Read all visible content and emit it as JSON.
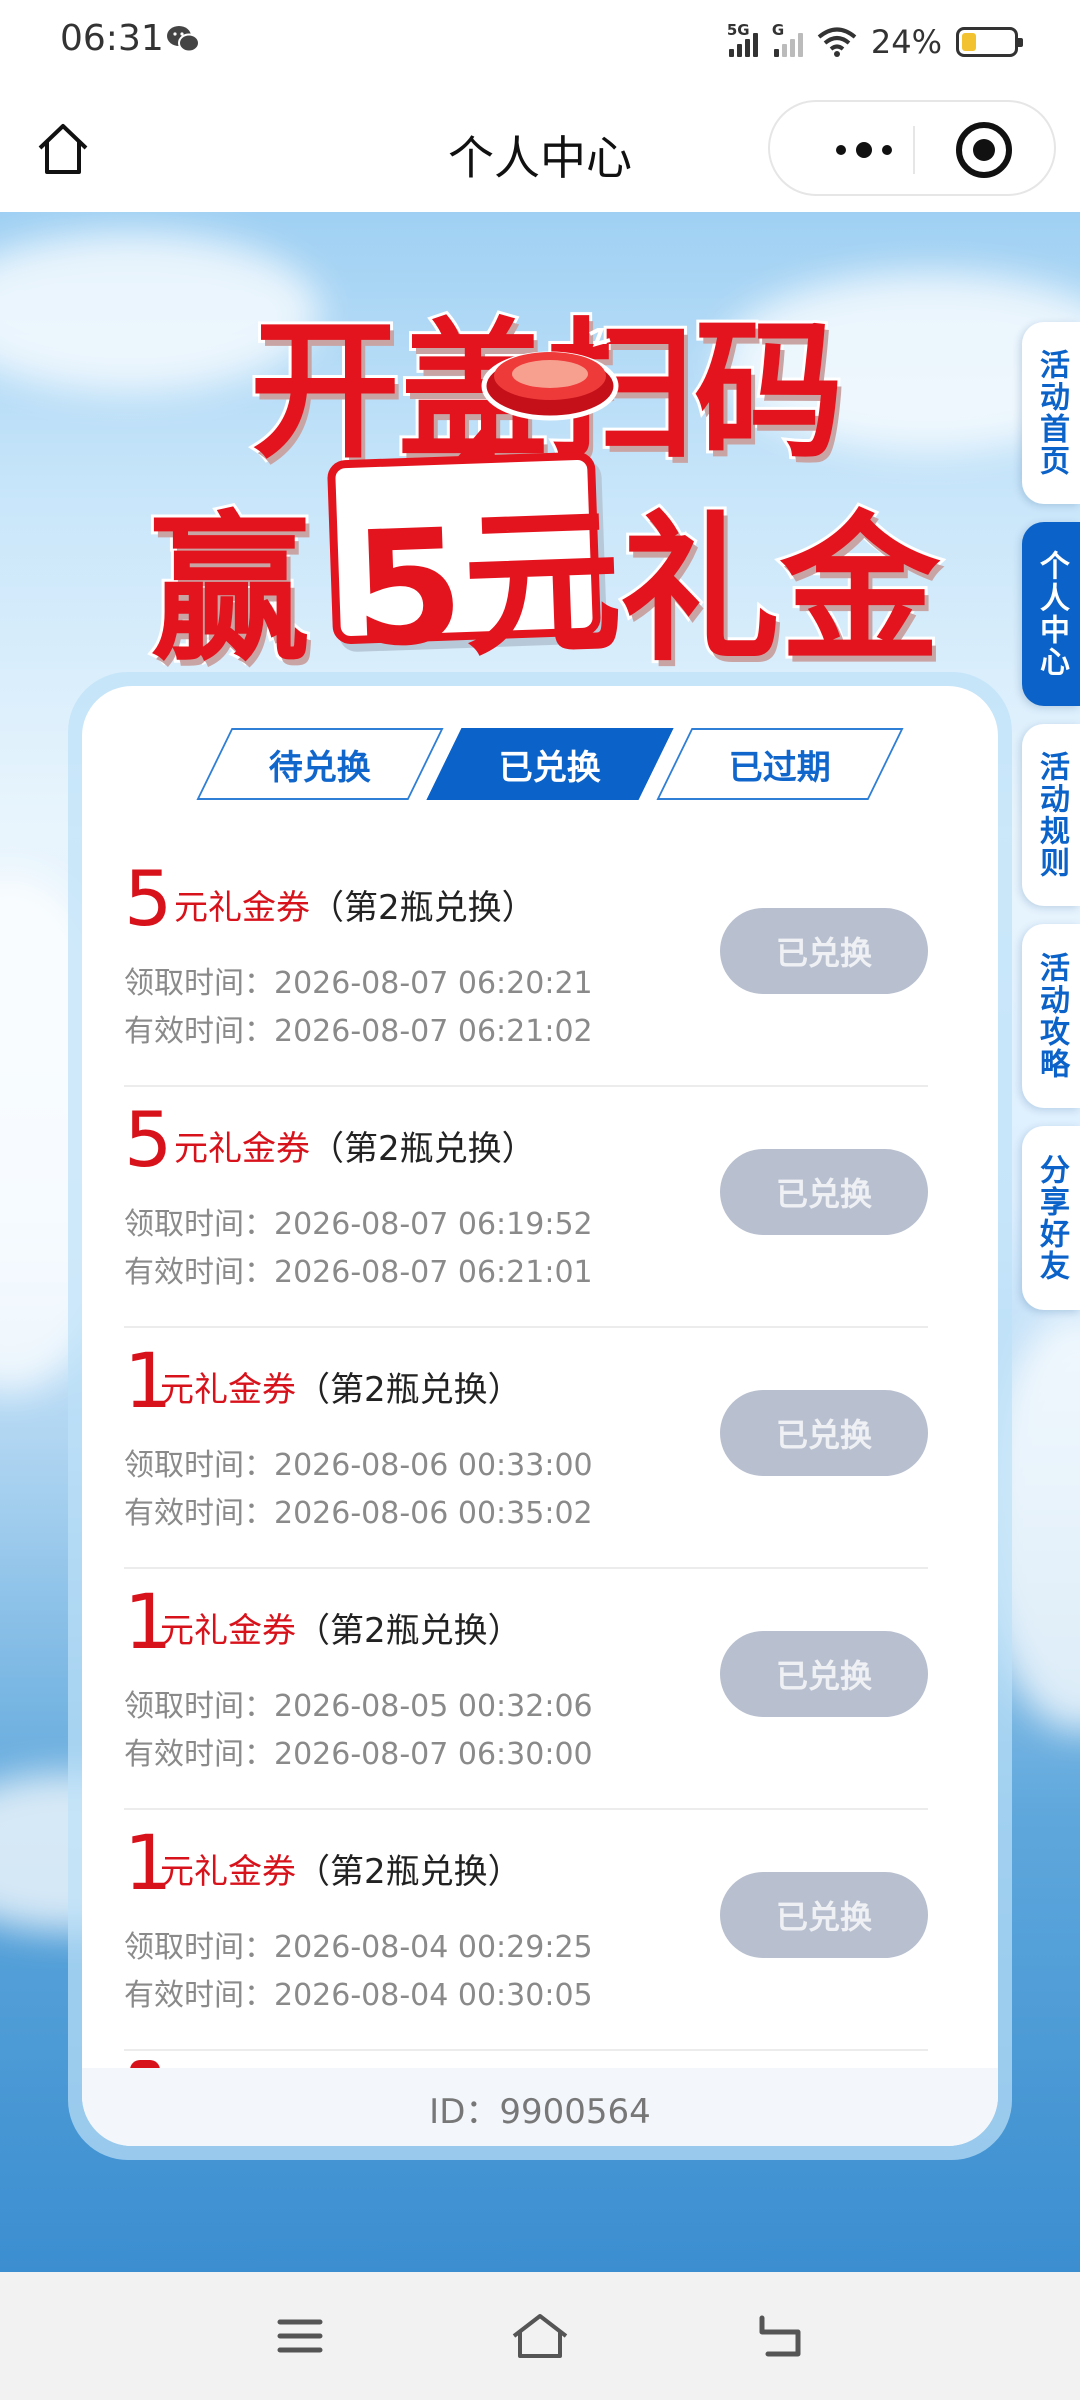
{
  "status_bar": {
    "time": "06:31",
    "signal1_tag": "5G",
    "signal2_tag": "G",
    "battery_percent": "24%"
  },
  "nav": {
    "title": "个人中心"
  },
  "banner": {
    "line1": "开盖扫码",
    "line2_prefix": "赢",
    "line2_amount": "5元",
    "line2_suffix": "礼金"
  },
  "side_tabs": [
    {
      "label": "活动首页",
      "active": false
    },
    {
      "label": "个人中心",
      "active": true
    },
    {
      "label": "活动规则",
      "active": false
    },
    {
      "label": "活动攻略",
      "active": false
    },
    {
      "label": "分享好友",
      "active": false
    }
  ],
  "tabs": [
    {
      "label": "待兑换",
      "active": false
    },
    {
      "label": "已兑换",
      "active": true
    },
    {
      "label": "已过期",
      "active": false
    }
  ],
  "coupons": [
    {
      "amount": "5",
      "name": "元礼金券",
      "note": "（第2瓶兑换）",
      "claim_label": "领取时间：",
      "claim_time": "2026-08-07 06:20:21",
      "valid_label": "有效时间：",
      "valid_time": "2026-08-07 06:21:02",
      "status": "已兑换"
    },
    {
      "amount": "5",
      "name": "元礼金券",
      "note": "（第2瓶兑换）",
      "claim_label": "领取时间：",
      "claim_time": "2026-08-07 06:19:52",
      "valid_label": "有效时间：",
      "valid_time": "2026-08-07 06:21:01",
      "status": "已兑换"
    },
    {
      "amount": "1",
      "name": "元礼金券",
      "note": "（第2瓶兑换）",
      "claim_label": "领取时间：",
      "claim_time": "2026-08-06 00:33:00",
      "valid_label": "有效时间：",
      "valid_time": "2026-08-06 00:35:02",
      "status": "已兑换"
    },
    {
      "amount": "1",
      "name": "元礼金券",
      "note": "（第2瓶兑换）",
      "claim_label": "领取时间：",
      "claim_time": "2026-08-05 00:32:06",
      "valid_label": "有效时间：",
      "valid_time": "2026-08-07 06:30:00",
      "status": "已兑换"
    },
    {
      "amount": "1",
      "name": "元礼金券",
      "note": "（第2瓶兑换）",
      "claim_label": "领取时间：",
      "claim_time": "2026-08-04 00:29:25",
      "valid_label": "有效时间：",
      "valid_time": "2026-08-04 00:30:05",
      "status": "已兑换"
    }
  ],
  "footer": {
    "user_id": "ID：9900564"
  },
  "colors": {
    "brand_red": "#e3141d",
    "brand_blue": "#0b62c8",
    "redeemed_button": "#b8bfcf"
  }
}
